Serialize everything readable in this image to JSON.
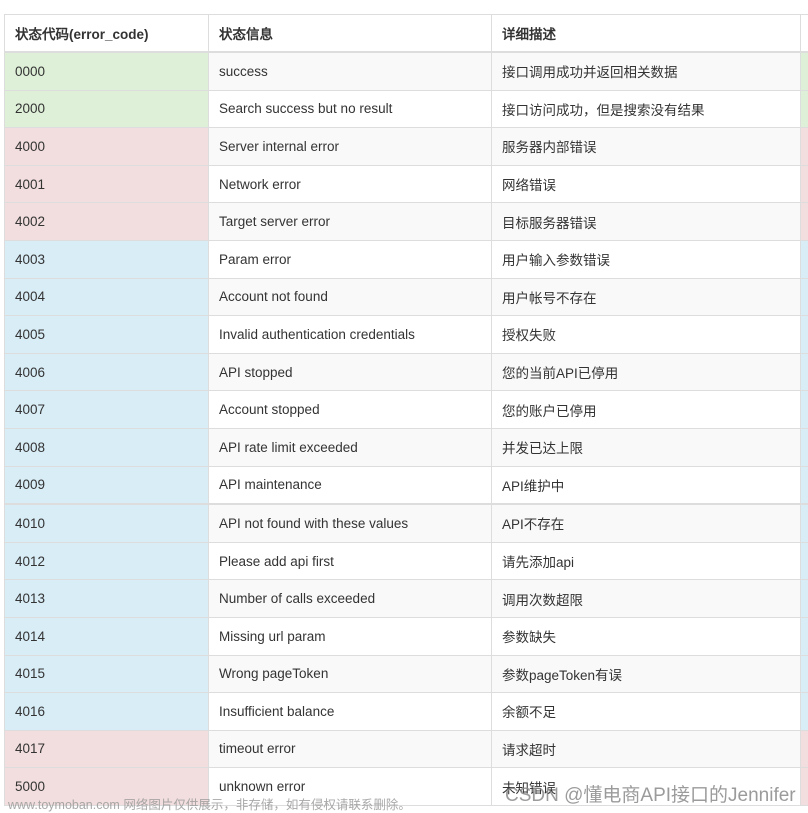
{
  "table": {
    "headers": [
      "状态代码(error_code)",
      "状态信息",
      "详细描述"
    ],
    "rows": [
      {
        "code": "0000",
        "message": "success",
        "description": "接口调用成功并返回相关数据",
        "status": "success"
      },
      {
        "code": "2000",
        "message": "Search success but no result",
        "description": "接口访问成功，但是搜索没有结果",
        "status": "success"
      },
      {
        "code": "4000",
        "message": "Server internal error",
        "description": "服务器内部错误",
        "status": "danger"
      },
      {
        "code": "4001",
        "message": "Network error",
        "description": "网络错误",
        "status": "danger"
      },
      {
        "code": "4002",
        "message": "Target server error",
        "description": "目标服务器错误",
        "status": "danger"
      },
      {
        "code": "4003",
        "message": "Param error",
        "description": "用户输入参数错误",
        "status": "info"
      },
      {
        "code": "4004",
        "message": "Account not found",
        "description": "用户帐号不存在",
        "status": "info"
      },
      {
        "code": "4005",
        "message": "Invalid authentication credentials",
        "description": "授权失败",
        "status": "info"
      },
      {
        "code": "4006",
        "message": "API stopped",
        "description": "您的当前API已停用",
        "status": "info"
      },
      {
        "code": "4007",
        "message": "Account stopped",
        "description": "您的账户已停用",
        "status": "info"
      },
      {
        "code": "4008",
        "message": "API rate limit exceeded",
        "description": "并发已达上限",
        "status": "info"
      },
      {
        "code": "4009",
        "message": "API maintenance",
        "description": "API维护中",
        "status": "info"
      },
      {
        "code": "4010",
        "message": "API not found with these values",
        "description": "API不存在",
        "status": "info"
      },
      {
        "code": "4012",
        "message": "Please add api first",
        "description": "请先添加api",
        "status": "info"
      },
      {
        "code": "4013",
        "message": "Number of calls exceeded",
        "description": "调用次数超限",
        "status": "info"
      },
      {
        "code": "4014",
        "message": "Missing url param",
        "description": "参数缺失",
        "status": "info"
      },
      {
        "code": "4015",
        "message": "Wrong pageToken",
        "description": "参数pageToken有误",
        "status": "info"
      },
      {
        "code": "4016",
        "message": "Insufficient balance",
        "description": "余额不足",
        "status": "info"
      },
      {
        "code": "4017",
        "message": "timeout error",
        "description": "请求超时",
        "status": "danger"
      },
      {
        "code": "5000",
        "message": "unknown error",
        "description": "未知错误",
        "status": "danger"
      }
    ]
  },
  "watermarks": {
    "left": "www.toymoban.com 网络图片仅供展示，非存储，如有侵权请联系删除。",
    "right": "CSDN @懂电商API接口的Jennifer"
  },
  "colors": {
    "success": "#dff0d8",
    "danger": "#f2dede",
    "info": "#d9edf7",
    "border": "#dddddd"
  }
}
